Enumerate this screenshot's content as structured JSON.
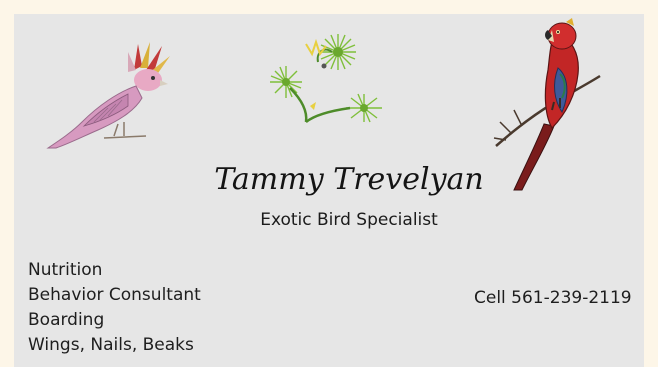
{
  "card": {
    "name": "Tammy Trevelyan",
    "title": "Exotic Bird Specialist",
    "services": [
      "Nutrition",
      "Behavior Consultant",
      "Boarding",
      "Wings, Nails, Beaks"
    ],
    "cell": "Cell 561-239-2119"
  },
  "illustrations": [
    {
      "icon": "pink-cockatoo-icon"
    },
    {
      "icon": "sunflower-sprigs-icon"
    },
    {
      "icon": "red-macaw-on-branch-icon"
    }
  ],
  "colors": {
    "page_background": "#fdf6e8",
    "card_background": "#e6e6e6",
    "text": "#1e1e1e"
  }
}
